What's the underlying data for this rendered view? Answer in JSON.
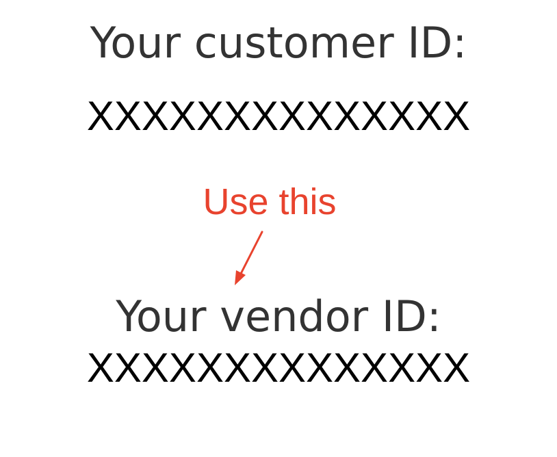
{
  "customer": {
    "label": "Your customer ID:",
    "value": "XXXXXXXXXXXXXX"
  },
  "annotation": {
    "text": "Use this",
    "color": "#e8432e"
  },
  "vendor": {
    "label": "Your vendor ID:",
    "value": "XXXXXXXXXXXXXX"
  },
  "colors": {
    "label": "#333333",
    "value": "#000000",
    "background": "#ffffff"
  }
}
